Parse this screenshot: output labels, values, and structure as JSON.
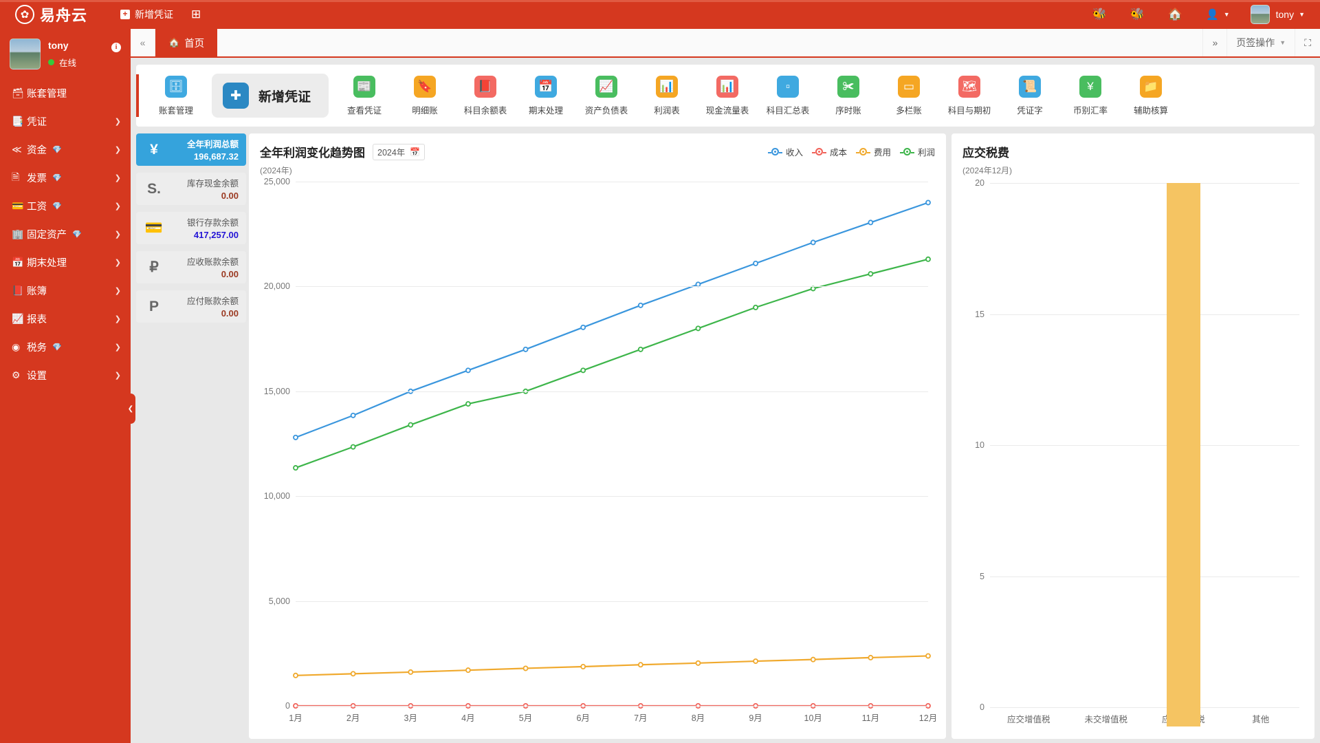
{
  "header": {
    "logo_text": "易舟云",
    "logo_icon": "flower-logo-icon",
    "new_voucher_label": "新增凭证",
    "grid_icon": "grid-icon",
    "bug_icon_1": "bug-icon",
    "bug_icon_2": "bug-icon",
    "home_icon": "home-icon",
    "user_switch_icon": "user-switch-icon",
    "user_name": "tony",
    "avatar_name": "avatar"
  },
  "sidebar": {
    "user_name": "tony",
    "status_text": "在线",
    "info_icon": "info-icon",
    "items": [
      {
        "label": "账套管理",
        "icon": "account-book-icon",
        "gem": false,
        "arrow": false
      },
      {
        "label": "凭证",
        "icon": "voucher-icon",
        "gem": false,
        "arrow": true
      },
      {
        "label": "资金",
        "icon": "funds-icon",
        "gem": true,
        "arrow": true
      },
      {
        "label": "发票",
        "icon": "invoice-icon",
        "gem": true,
        "arrow": true
      },
      {
        "label": "工资",
        "icon": "payroll-icon",
        "gem": true,
        "arrow": true
      },
      {
        "label": "固定资产",
        "icon": "asset-icon",
        "gem": true,
        "arrow": true
      },
      {
        "label": "期末处理",
        "icon": "calendar-icon",
        "gem": false,
        "arrow": true
      },
      {
        "label": "账簿",
        "icon": "ledger-icon",
        "gem": false,
        "arrow": true
      },
      {
        "label": "报表",
        "icon": "report-chart-icon",
        "gem": false,
        "arrow": true
      },
      {
        "label": "税务",
        "icon": "tax-icon",
        "gem": true,
        "arrow": true
      },
      {
        "label": "设置",
        "icon": "gear-icon",
        "gem": false,
        "arrow": true
      }
    ],
    "collapse_icon": "chevron-left-icon"
  },
  "tabbar": {
    "collapse_icon": "double-chevron-left-icon",
    "tabs": [
      {
        "label": "首页",
        "icon": "home-icon",
        "active": true
      }
    ],
    "expand_icon": "double-chevron-right-icon",
    "ops_label": "页签操作",
    "fullscreen_icon": "fullscreen-icon"
  },
  "quickbar": [
    {
      "label": "账套管理",
      "icon": "account-box-icon",
      "color": "#3fa9e0",
      "featured": false
    },
    {
      "label": "新增凭证",
      "icon": "plus-square-icon",
      "color": "#2b88c3",
      "featured": true
    },
    {
      "label": "查看凭证",
      "icon": "news-icon",
      "color": "#49bd5f",
      "featured": false
    },
    {
      "label": "明细账",
      "icon": "bookmark-icon",
      "color": "#f5a623",
      "featured": false
    },
    {
      "label": "科目余额表",
      "icon": "book-red-icon",
      "color": "#f36a63",
      "featured": false
    },
    {
      "label": "期末处理",
      "icon": "calendar-blue-icon",
      "color": "#3fa9e0",
      "featured": false
    },
    {
      "label": "资产负债表",
      "icon": "trend-up-icon",
      "color": "#49bd5f",
      "featured": false
    },
    {
      "label": "利润表",
      "icon": "area-chart-icon",
      "color": "#f5a623",
      "featured": false
    },
    {
      "label": "现金流量表",
      "icon": "bar-chart-icon",
      "color": "#f36a63",
      "featured": false
    },
    {
      "label": "科目汇总表",
      "icon": "columns-icon",
      "color": "#3fa9e0",
      "featured": false
    },
    {
      "label": "序时账",
      "icon": "crop-icon",
      "color": "#49bd5f",
      "featured": false
    },
    {
      "label": "多栏账",
      "icon": "table-icon",
      "color": "#f5a623",
      "featured": false
    },
    {
      "label": "科目与期初",
      "icon": "sitemap-icon",
      "color": "#f36a63",
      "featured": false
    },
    {
      "label": "凭证字",
      "icon": "stamp-icon",
      "color": "#3fa9e0",
      "featured": false
    },
    {
      "label": "币别汇率",
      "icon": "yen-icon",
      "color": "#49bd5f",
      "featured": false
    },
    {
      "label": "辅助核算",
      "icon": "folder-icon",
      "color": "#f5a623",
      "featured": false
    }
  ],
  "stats": [
    {
      "label": "全年利润总额",
      "value": "196,687.32",
      "icon": "yen-icon",
      "primary": true,
      "blue": false
    },
    {
      "label": "库存现金余额",
      "value": "0.00",
      "icon": "cash-s-icon",
      "primary": false,
      "blue": false
    },
    {
      "label": "银行存款余额",
      "value": "417,257.00",
      "icon": "bank-card-icon",
      "primary": false,
      "blue": true
    },
    {
      "label": "应收账款余额",
      "value": "0.00",
      "icon": "ruble-icon",
      "primary": false,
      "blue": false
    },
    {
      "label": "应付账款余额",
      "value": "0.00",
      "icon": "paypal-p-icon",
      "primary": false,
      "blue": false
    }
  ],
  "line_card": {
    "title": "全年利润变化趋势图",
    "date_value": "2024年",
    "calendar_icon": "calendar-icon",
    "subtitle": "(2024年)"
  },
  "bar_card": {
    "title": "应交税费",
    "subtitle": "(2024年12月)"
  },
  "chart_data": [
    {
      "type": "line",
      "title": "全年利润变化趋势图",
      "subtitle": "(2024年)",
      "xlabel": "",
      "ylabel": "",
      "x": [
        "1月",
        "2月",
        "3月",
        "4月",
        "5月",
        "6月",
        "7月",
        "8月",
        "9月",
        "10月",
        "11月",
        "12月"
      ],
      "ylim": [
        0,
        25000
      ],
      "yticks": [
        0,
        5000,
        10000,
        15000,
        20000,
        25000
      ],
      "ytick_labels": [
        "0",
        "5,000",
        "10,000",
        "15,000",
        "20,000",
        "25,000"
      ],
      "grid": true,
      "legend_position": "top-right",
      "series": [
        {
          "name": "收入",
          "color": "#3a96dd",
          "values": [
            12800,
            13850,
            15000,
            16000,
            17000,
            18050,
            19100,
            20100,
            21100,
            22100,
            23050,
            24000
          ]
        },
        {
          "name": "成本",
          "color": "#f1635a",
          "values": [
            0,
            0,
            0,
            0,
            0,
            0,
            0,
            0,
            0,
            0,
            0,
            0
          ]
        },
        {
          "name": "费用",
          "color": "#f0a92d",
          "values": [
            1450,
            1530,
            1610,
            1700,
            1790,
            1870,
            1960,
            2040,
            2130,
            2210,
            2300,
            2380
          ]
        },
        {
          "name": "利润",
          "color": "#3db54a",
          "values": [
            11350,
            12350,
            13400,
            14400,
            15000,
            16000,
            17000,
            18000,
            19000,
            19900,
            20600,
            21300
          ]
        }
      ]
    },
    {
      "type": "bar",
      "title": "应交税费",
      "subtitle": "(2024年12月)",
      "categories": [
        "应交增值税",
        "未交增值税",
        "应交所得税",
        "其他"
      ],
      "values": [
        0,
        0,
        20,
        0
      ],
      "color": "#f5c462",
      "ylim": [
        0,
        20
      ],
      "yticks": [
        0,
        5,
        10,
        15,
        20
      ],
      "ytick_labels": [
        "0",
        "5",
        "10",
        "15",
        "20"
      ],
      "grid": true,
      "xlabel": "",
      "ylabel": ""
    }
  ]
}
